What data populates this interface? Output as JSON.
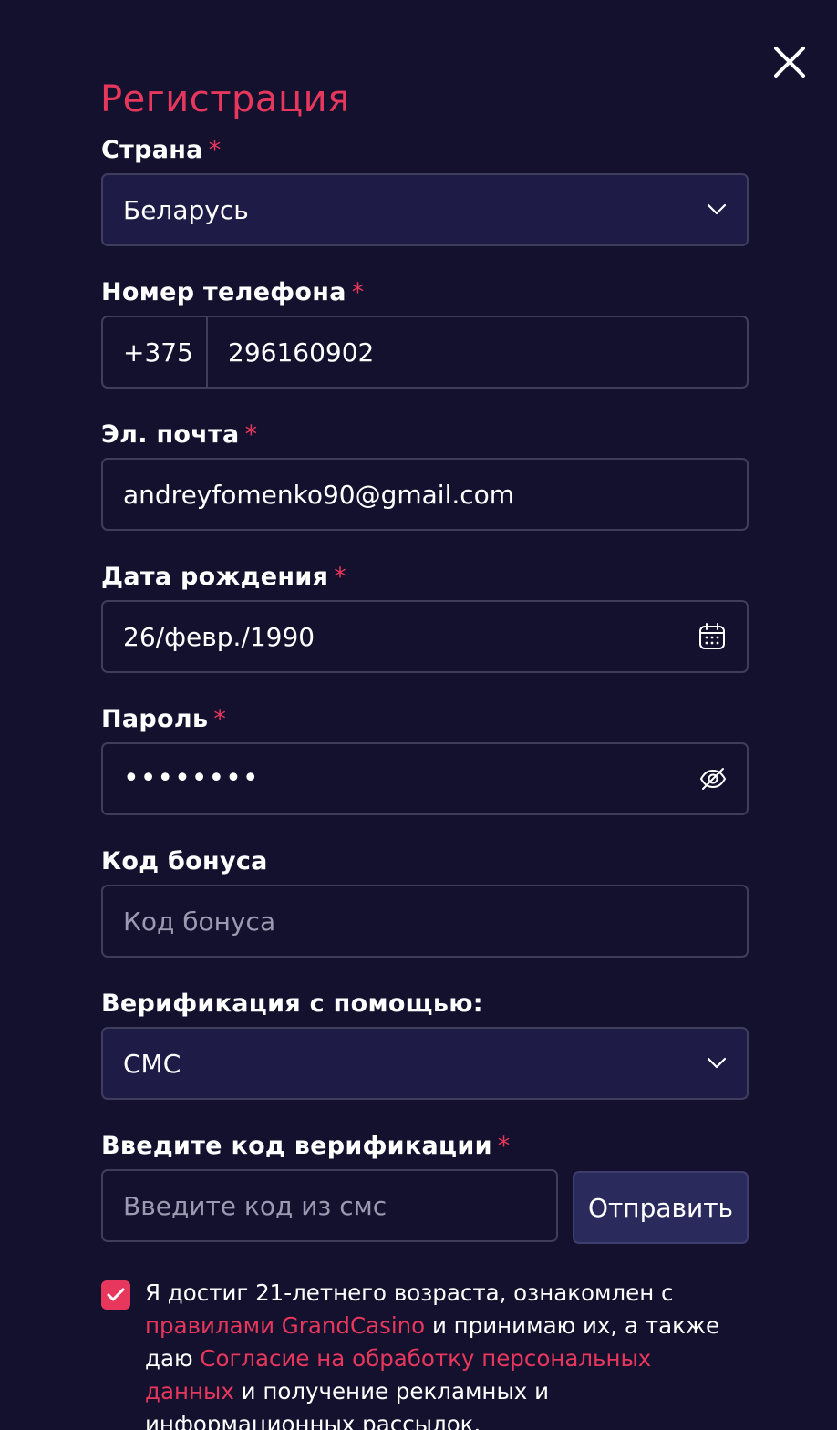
{
  "modal": {
    "title": "Регистрация",
    "required_mark": "*"
  },
  "country": {
    "label": "Страна",
    "value": "Беларусь"
  },
  "phone": {
    "label": "Номер телефона",
    "prefix": "+375",
    "value": "296160902"
  },
  "email": {
    "label": "Эл. почта",
    "value": "andreyfomenko90@gmail.com"
  },
  "birthdate": {
    "label": "Дата рождения",
    "value": "26/февр./1990"
  },
  "password": {
    "label": "Пароль",
    "masked_value": "••••••••"
  },
  "bonus": {
    "label": "Код бонуса",
    "placeholder": "Код бонуса"
  },
  "verification_method": {
    "label": "Верификация с помощью:",
    "value": "СМС"
  },
  "verification_code": {
    "label": "Введите код верификации",
    "placeholder": "Введите код из смс",
    "send_label": "Отправить"
  },
  "consent": {
    "checked": true,
    "text_1": "Я достиг 21-летнего возраста, ознакомлен с ",
    "link_rules": "правилами GrandCasino",
    "text_2": " и принимаю их, а также даю ",
    "link_consent": "Согласие на обработку персональных данных",
    "text_3": " и получение рекламных и информационных рассылок."
  },
  "colors": {
    "background": "#13112e",
    "accent": "#e8375d",
    "select_bg": "#1e1c47",
    "border": "#3e3d5c",
    "button_bg": "#2b2a5c"
  },
  "icons": {
    "close": "close-icon",
    "chevron": "chevron-down-icon",
    "calendar": "calendar-icon",
    "eye": "eye-off-icon",
    "check": "check-icon"
  }
}
